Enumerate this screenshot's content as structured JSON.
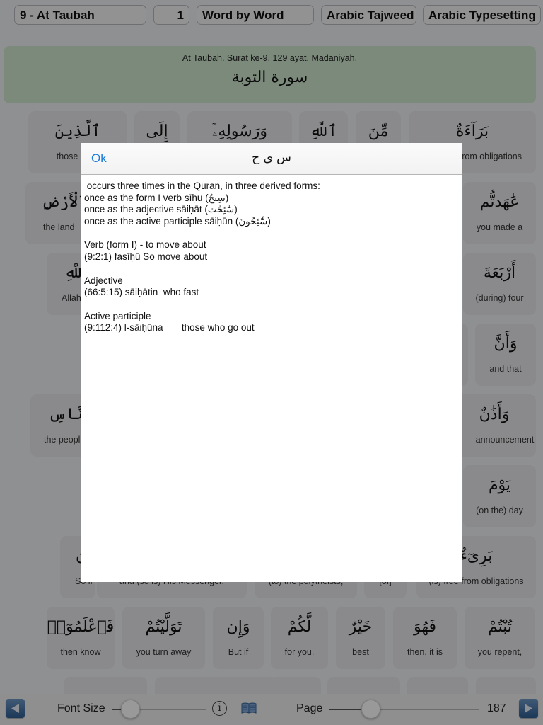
{
  "toolbar": {
    "surah_select": "9 - At Taubah",
    "ayah_number": "1",
    "view_mode": "Word by Word",
    "arabic_tajweed": "Arabic Tajweed",
    "arabic_typesetting": "Arabic Typesetting"
  },
  "header": {
    "info": "At Taubah. Surat ke-9. 129 ayat. Madaniyah.",
    "arabic_title": "سورة التوبة"
  },
  "tiles": [
    {
      "ar": "ٱلَّذِينَ",
      "en": "those (with"
    },
    {
      "ar": "إِلَى",
      "en": ""
    },
    {
      "ar": "وَرَسُولِهِۦٓ",
      "en": ""
    },
    {
      "ar": "ٱللَّهِ",
      "en": ""
    },
    {
      "ar": "مِّنَ",
      "en": ""
    },
    {
      "ar": "بَرَآءَةٌ",
      "en": "from obligations"
    },
    {
      "ar": "ٱلْأَرْضِ",
      "en": "the land"
    },
    {
      "ar": "عَٰهَدتُّم",
      "en": "you made a"
    },
    {
      "ar": "ٱللَّهِ",
      "en": "Allah"
    },
    {
      "ar": "أَرْبَعَةَ",
      "en": "(during) four"
    },
    {
      "ar": "وَأَنَّ",
      "en": "and that"
    },
    {
      "ar": "ٱلنَّاسِ",
      "en": "the peopl"
    },
    {
      "ar": "وَأَذَٰنٌ",
      "en": "announcement"
    },
    {
      "ar": "يَوْمَ",
      "en": "(on the) day"
    },
    {
      "ar": "ن",
      "en": "So if"
    },
    {
      "ar": "",
      "en": "and (so is) His Messenger."
    },
    {
      "ar": "",
      "en": "(to) the polytheists,"
    },
    {
      "ar": "",
      "en": "[of]"
    },
    {
      "ar": "بَرِىٓءٌ",
      "en": "(is) free from obligations"
    },
    {
      "ar": "فَٱعْلَمُوٓا۟",
      "en": "then know"
    },
    {
      "ar": "تَوَلَّيْتُمْ",
      "en": "you turn away"
    },
    {
      "ar": "وَإِن",
      "en": "But if"
    },
    {
      "ar": "لَّكُمْ",
      "en": "for you."
    },
    {
      "ar": "خَيْرٌ",
      "en": "best"
    },
    {
      "ar": "فَهُوَ",
      "en": "then, it is"
    },
    {
      "ar": "تُبْتُمْ",
      "en": "you repent,"
    }
  ],
  "bottombar": {
    "prev_icon": "triangle-left-icon",
    "font_size_label": "Font Size",
    "font_size_value": 0.2,
    "info_icon": "info-icon",
    "book_icon": "book-icon",
    "page_label": "Page",
    "page_value": 187,
    "page_slider_fraction": 0.28,
    "next_icon": "triangle-right-icon"
  },
  "popover": {
    "ok_label": "Ok",
    "root_title": "س ى ح",
    "lines": [
      " occurs three times in the Quran, in three derived forms:",
      "once as the form I verb sīḥu (سِيحُ)",
      "once as the adjective sāiḥāt (سَٰٓئِحَٰت)",
      "once as the active participle sāiḥūn (سَّٰٓئِحُونَ)",
      "",
      "Verb (form I) - to move about",
      "(9:2:1) fasīḥū So move about",
      "",
      "Adjective",
      "(66:5:15) sāiḥātin  who fast",
      "",
      "Active participle",
      "(9:112:4) l-sāiḥūna       those who go out"
    ]
  }
}
